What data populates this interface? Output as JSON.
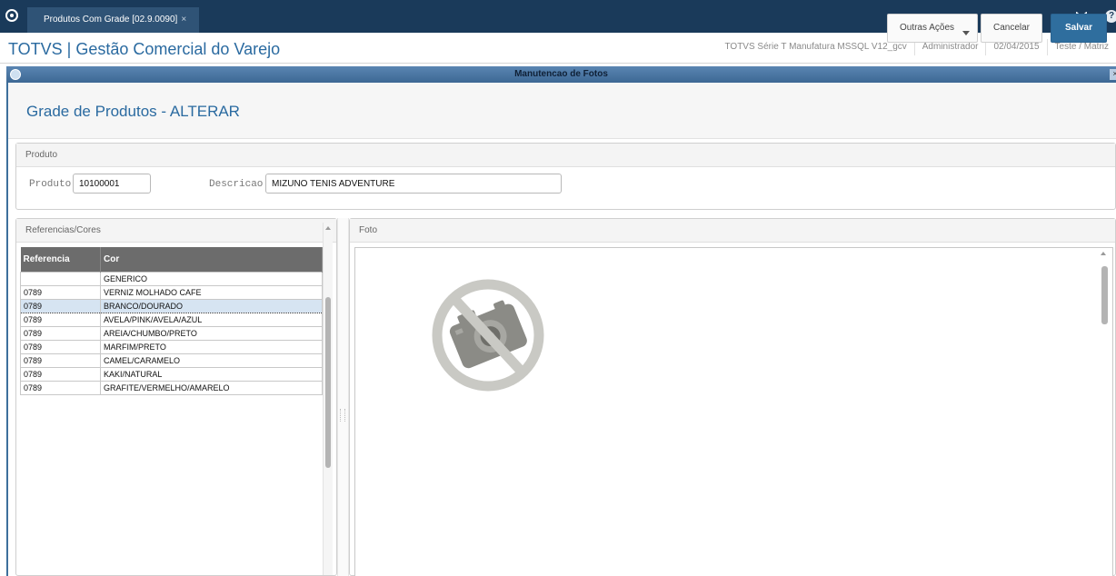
{
  "topbar": {
    "tab_label": "Produtos Com Grade [02.9.0090]",
    "tab_close": "×",
    "home_icon": "totvs-logo-icon",
    "help_glyph": "?"
  },
  "header": {
    "app_title": "TOTVS | Gestão Comercial do Varejo",
    "environment": "TOTVS Série T Manufatura MSSQL V12_gcv",
    "user": "Administrador",
    "date": "02/04/2015",
    "branch": "Teste / Matriz"
  },
  "dialog": {
    "caption": "Manutencao de Fotos",
    "close_glyph": "×"
  },
  "form": {
    "title": "Grade de Produtos - ALTERAR",
    "more_actions_label": "Outras Ações",
    "cancel_label": "Cancelar",
    "save_label": "Salvar"
  },
  "produto_panel": {
    "heading": "Produto",
    "produto_label": "Produto",
    "produto_value": "10100001",
    "descricao_label": "Descricao",
    "descricao_value": "MIZUNO TENIS ADVENTURE"
  },
  "refs_panel": {
    "heading": "Referencias/Cores",
    "columns": [
      "Referencia",
      "Cor"
    ],
    "rows": [
      {
        "ref": "",
        "cor": "GENERICO"
      },
      {
        "ref": "0789",
        "cor": "VERNIZ MOLHADO CAFE"
      },
      {
        "ref": "0789",
        "cor": "BRANCO/DOURADO",
        "selected": true
      },
      {
        "ref": "0789",
        "cor": "AVELA/PINK/AVELA/AZUL"
      },
      {
        "ref": "0789",
        "cor": "AREIA/CHUMBO/PRETO"
      },
      {
        "ref": "0789",
        "cor": "MARFIM/PRETO"
      },
      {
        "ref": "0789",
        "cor": "CAMEL/CARAMELO"
      },
      {
        "ref": "0789",
        "cor": "KAKI/NATURAL"
      },
      {
        "ref": "0789",
        "cor": "GRAFITE/VERMELHO/AMARELO"
      }
    ]
  },
  "foto_panel": {
    "heading": "Foto",
    "placeholder_icon": "no-photo-icon"
  },
  "colors": {
    "topbar": "#1a3a5a",
    "accent": "#2a6aa0",
    "save_button": "#2f6e9e",
    "selected_row": "#d6e4f2"
  }
}
